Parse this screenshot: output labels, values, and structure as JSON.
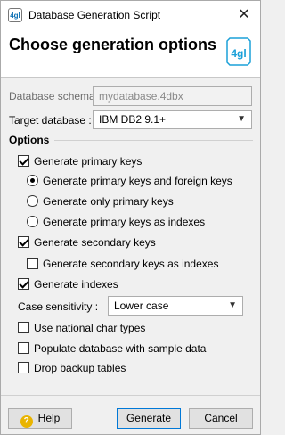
{
  "window": {
    "title": "Database Generation Script",
    "app_icon_text": "4gl",
    "close_glyph": "✕"
  },
  "header": {
    "title": "Choose generation options",
    "logo_text": "4gl",
    "logo_color": "#1aa0d8"
  },
  "form": {
    "schema_label": "Database schema :",
    "schema_value": "mydatabase.4dbx",
    "target_label": "Target database :",
    "target_value": "IBM DB2 9.1+"
  },
  "options": {
    "section_title": "Options",
    "generate_primary_keys": {
      "label": "Generate primary keys",
      "checked": true
    },
    "pk_mode": [
      {
        "label": "Generate primary keys and foreign keys",
        "selected": true
      },
      {
        "label": "Generate only primary keys",
        "selected": false
      },
      {
        "label": "Generate primary keys as indexes",
        "selected": false
      }
    ],
    "generate_secondary_keys": {
      "label": "Generate secondary keys",
      "checked": true
    },
    "secondary_as_indexes": {
      "label": "Generate secondary keys as indexes",
      "checked": false
    },
    "generate_indexes": {
      "label": "Generate indexes",
      "checked": true
    },
    "case_label": "Case sensitivity :",
    "case_value": "Lower case",
    "use_national": {
      "label": "Use national char types",
      "checked": false
    },
    "populate_sample": {
      "label": "Populate database with sample data",
      "checked": false
    },
    "drop_backup": {
      "label": "Drop backup tables",
      "checked": false
    }
  },
  "buttons": {
    "help": "Help",
    "generate": "Generate",
    "cancel": "Cancel"
  },
  "icons": {
    "help_icon": "question-mark",
    "dropdown_icon": "chevron-down"
  }
}
